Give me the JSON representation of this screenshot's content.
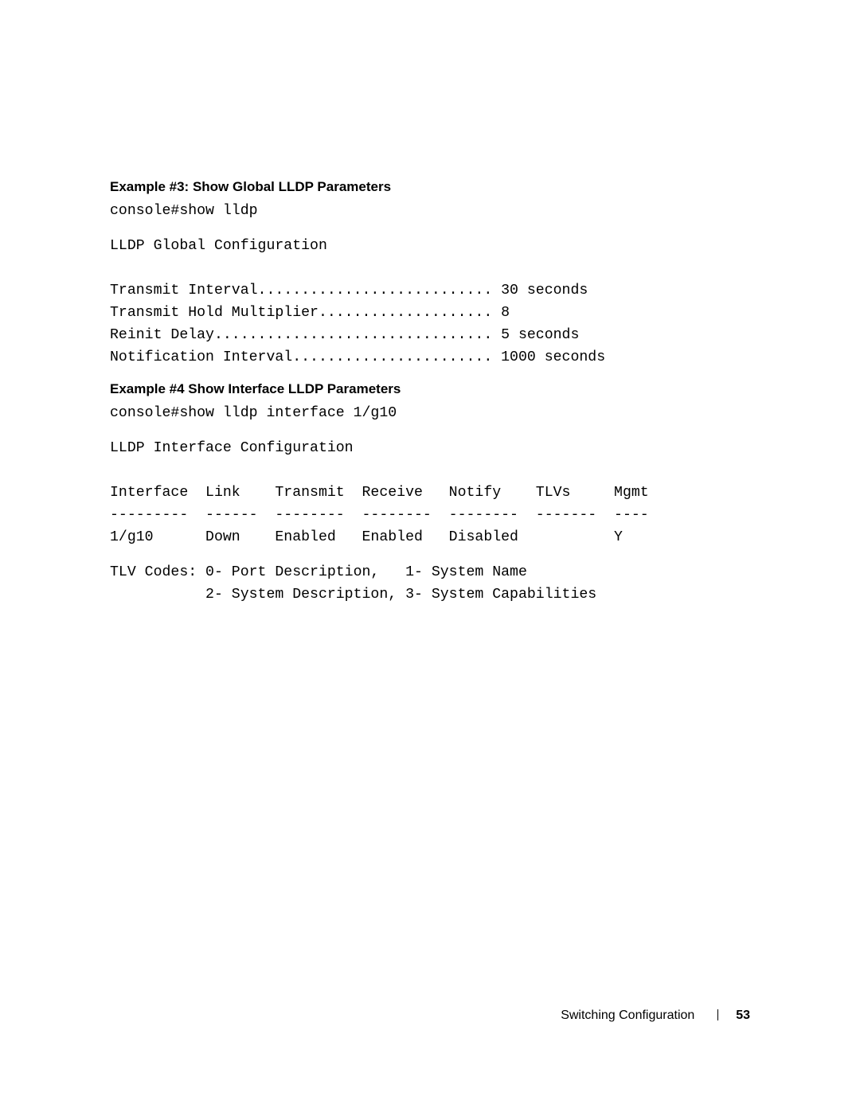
{
  "example3": {
    "heading": "Example #3: Show Global LLDP Parameters",
    "command": "console#show lldp",
    "section_title": "LLDP Global Configuration",
    "lines": [
      "Transmit Interval........................... 30 seconds",
      "Transmit Hold Multiplier.................... 8",
      "Reinit Delay................................ 5 seconds",
      "Notification Interval....................... 1000 seconds"
    ]
  },
  "example4": {
    "heading": "Example #4 Show Interface LLDP Parameters",
    "command": "console#show lldp interface 1/g10",
    "section_title": "LLDP Interface Configuration",
    "table_header": "Interface  Link    Transmit  Receive   Notify    TLVs     Mgmt",
    "table_divider": "---------  ------  --------  --------  --------  -------  ----",
    "table_row": "1/g10      Down    Enabled   Enabled   Disabled           Y",
    "codes_line1": "TLV Codes: 0- Port Description,   1- System Name",
    "codes_line2": "           2- System Description, 3- System Capabilities"
  },
  "footer": {
    "section": "Switching Configuration",
    "page": "53"
  }
}
